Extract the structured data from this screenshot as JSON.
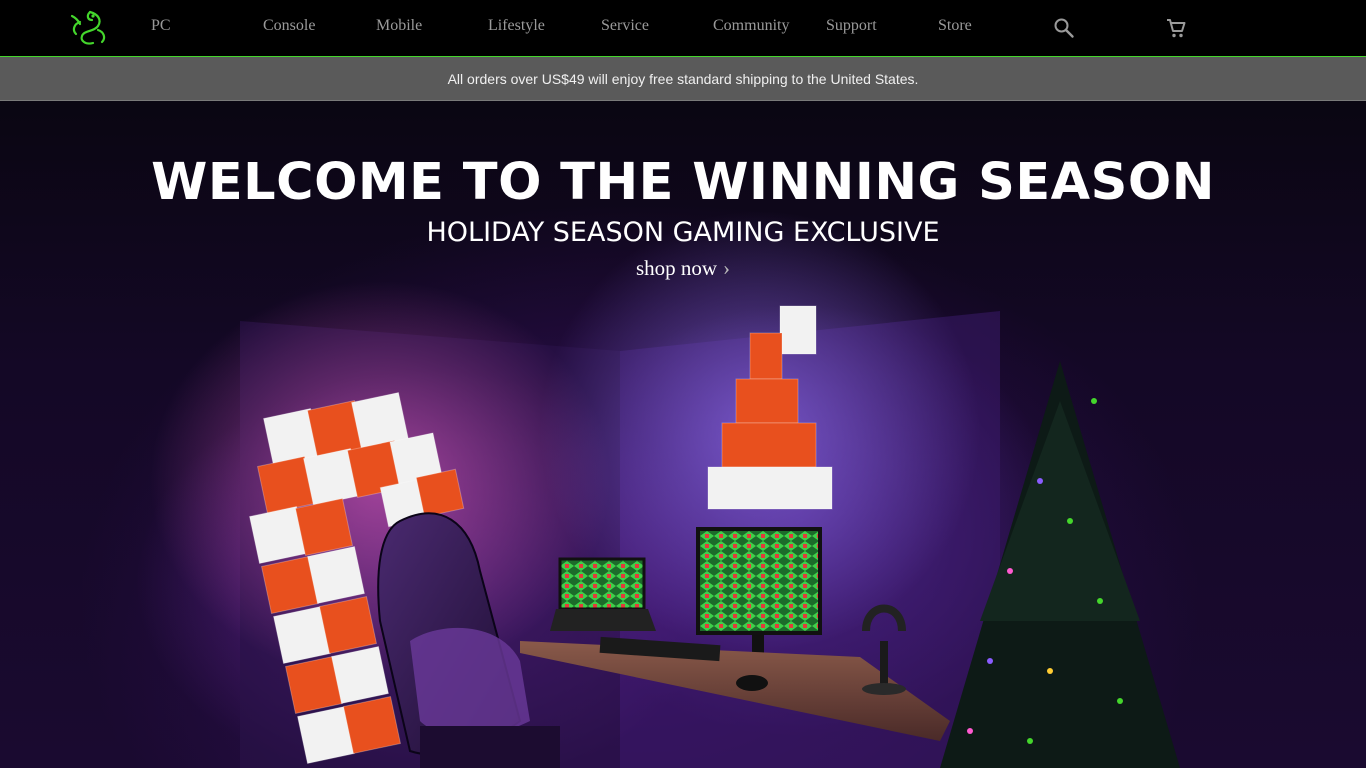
{
  "nav": {
    "logo_name": "razer-snake-logo",
    "items": [
      {
        "label": "PC"
      },
      {
        "label": "Console"
      },
      {
        "label": "Mobile"
      },
      {
        "label": "Lifestyle"
      },
      {
        "label": "Service"
      },
      {
        "label": "Community"
      },
      {
        "label": "Support"
      },
      {
        "label": "Store"
      }
    ],
    "icons": [
      "search-icon",
      "cart-icon"
    ]
  },
  "promo": {
    "text": "All orders over US$49 will enjoy free standard shipping to the United States."
  },
  "hero": {
    "title": "WELCOME TO THE WINNING SEASON",
    "subtitle": "HOLIDAY SEASON GAMING EXCLUSIVE",
    "cta": "shop now",
    "cta_chevron": "›"
  },
  "colors": {
    "brand_green": "#44d62c",
    "nav_text": "#9a9a9a",
    "promo_bg": "#5a5a5a",
    "tile_orange": "#e8501e",
    "tile_white": "#f2f2f2"
  }
}
